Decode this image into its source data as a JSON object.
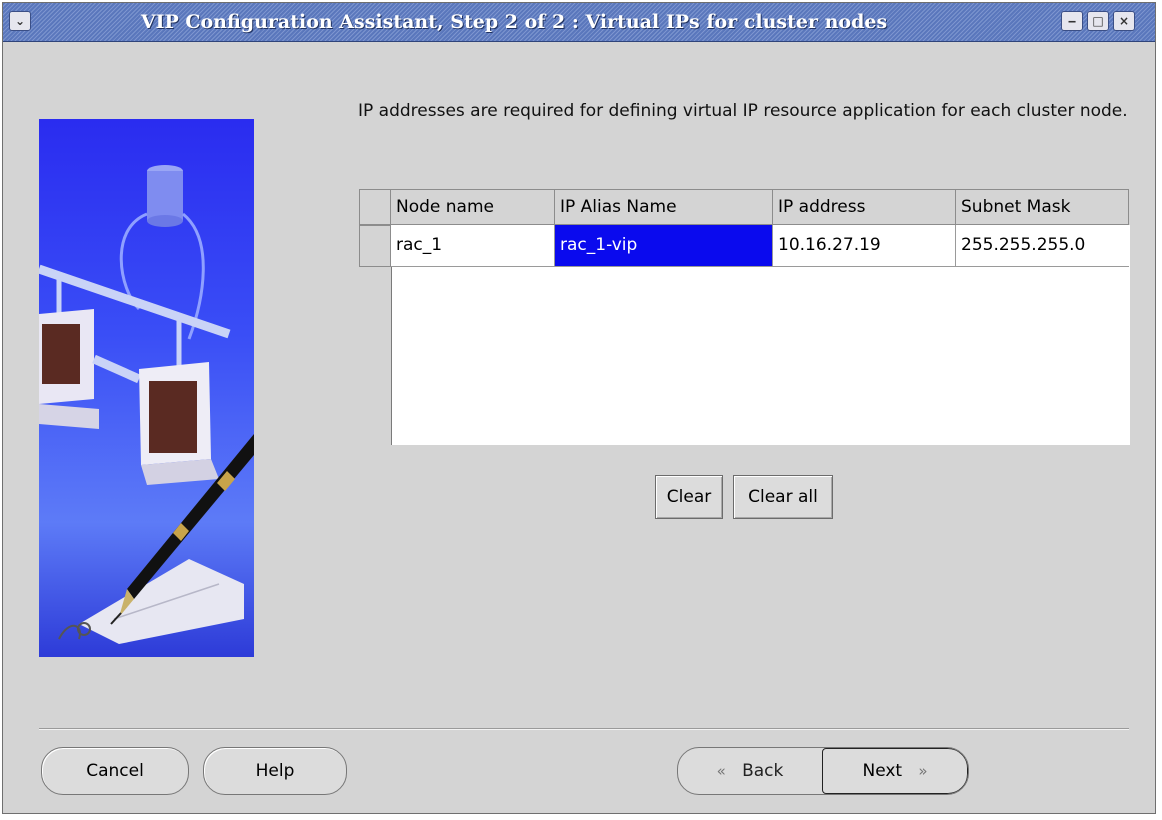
{
  "window": {
    "title": "VIP Configuration Assistant, Step 2 of 2 : Virtual IPs for cluster nodes"
  },
  "intro_text": "IP addresses are required for defining virtual IP resource application for each cluster node.",
  "table": {
    "columns": [
      "Node name",
      "IP Alias Name",
      "IP address",
      "Subnet Mask"
    ],
    "rows": [
      [
        "rac_1",
        "rac_1-vip",
        "10.16.27.19",
        "255.255.255.0"
      ]
    ],
    "selected_cell": "IP Alias Name"
  },
  "buttons": {
    "clear": "Clear",
    "clear_all": "Clear all",
    "cancel": "Cancel",
    "help": "Help",
    "back": "Back",
    "next": "Next"
  },
  "icons": {
    "back": "double-chevron-left-icon",
    "next": "double-chevron-right-icon",
    "window_menu": "chevron-down-icon"
  },
  "colors": {
    "selection": "#0a0aee",
    "titlebar": "#5874b8"
  }
}
